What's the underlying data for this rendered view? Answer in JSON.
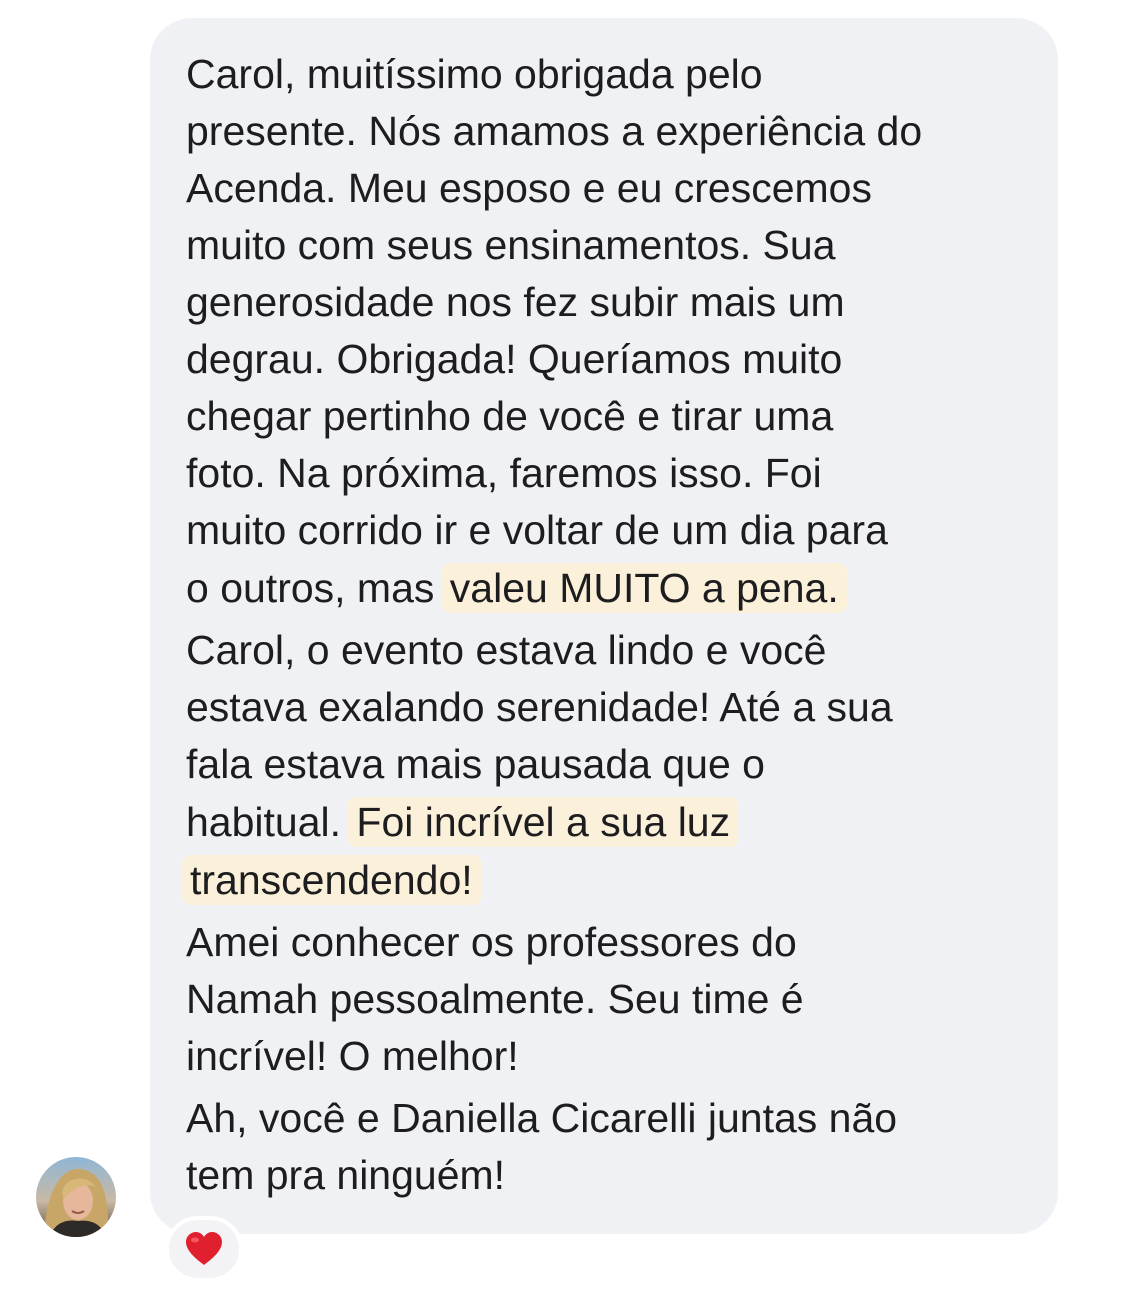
{
  "message": {
    "lines": [
      "Carol, muitíssimo obrigada pelo",
      "presente. Nós amamos a experiência do",
      "Acenda. Meu esposo e eu crescemos",
      "muito com seus ensinamentos. Sua",
      "generosidade nos fez subir mais um",
      "degrau. Obrigada! Queríamos muito",
      "chegar pertinho de você e tirar uma",
      "foto. Na próxima, faremos isso. Foi",
      "muito corrido ir e voltar de um dia para",
      "Carol, o evento estava lindo e você",
      "estava exalando serenidade! Até a sua",
      "fala estava mais pausada que o",
      "Amei conhecer os professores do",
      "Namah pessoalmente. Seu time é",
      "incrível! O melhor!",
      "Ah, você e Daniella Cicarelli juntas não",
      "tem pra ninguém!"
    ],
    "line_10_plain": "o outros, mas ",
    "line_10_highlight": "valeu MUITO a pena.",
    "line_14_plain": "habitual. ",
    "line_14_highlight": "Foi incrível a sua luz",
    "line_15_highlight": "transcendendo!"
  },
  "reaction": {
    "emoji": "❤️",
    "icon": "heart-icon"
  },
  "sender": {
    "avatar_icon": "avatar"
  },
  "colors": {
    "bubble": "#f0f1f5",
    "text": "#1d1d1f",
    "highlight": "#fbf1da",
    "heart": "#e0202e"
  }
}
